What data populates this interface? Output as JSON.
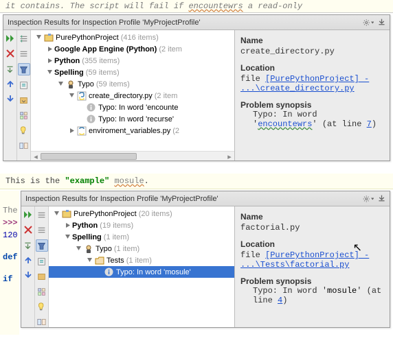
{
  "banner1": {
    "pre": "it contains. The script will fail if ",
    "typo": "encountewrs",
    "post": " a read-only"
  },
  "banner2": {
    "pre": "This is the ",
    "str": "\"example\"",
    "mid": " ",
    "typo": "mosule",
    "post": "."
  },
  "side": {
    "the": "The",
    "prompt": ">>>",
    "num": "120",
    "def": "def",
    "if": "if "
  },
  "panel1": {
    "title": "Inspection Results for Inspection Profile 'MyProjectProfile'",
    "tree": {
      "root": {
        "label": "PurePythonProject",
        "count": "(416 items)"
      },
      "gae": {
        "label": "Google App Engine (Python)",
        "count": "(2 item"
      },
      "python": {
        "label": "Python",
        "count": "(355 items)"
      },
      "spelling": {
        "label": "Spelling",
        "count": "(59 items)"
      },
      "typo": {
        "label": "Typo",
        "count": "(59 items)"
      },
      "file1": {
        "label": "create_directory.py",
        "count": "(2 item"
      },
      "msg1": "Typo: In word 'encounte",
      "msg2": "Typo: In word 'recurse'",
      "file2": {
        "label": "enviroment_variables.py",
        "count": "(2"
      }
    },
    "details": {
      "name_h": "Name",
      "name_v": "create_directory.py",
      "loc_h": "Location",
      "loc_pre": "file ",
      "loc_link": "[PurePythonProject] - ...\\create_directory.py",
      "syn_h": "Problem synopsis",
      "syn_pre": "Typo: In word '",
      "syn_word": "encountewrs",
      "syn_post": "' (at line ",
      "syn_line": "7",
      "syn_end": ")"
    }
  },
  "panel2": {
    "title": "Inspection Results for Inspection Profile 'MyProjectProfile'",
    "tree": {
      "root": {
        "label": "PurePythonProject",
        "count": "(20 items)"
      },
      "python": {
        "label": "Python",
        "count": "(19 items)"
      },
      "spelling": {
        "label": "Spelling",
        "count": "(1 item)"
      },
      "typo": {
        "label": "Typo",
        "count": "(1 item)"
      },
      "tests": {
        "label": "Tests",
        "count": "(1 item)"
      },
      "msg1": "Typo: In word 'mosule'"
    },
    "details": {
      "name_h": "Name",
      "name_v": "factorial.py",
      "loc_h": "Location",
      "loc_pre": "file ",
      "loc_link": "[PurePythonProject] - ...\\Tests\\factorial.py",
      "syn_h": "Problem synopsis",
      "syn_pre": "Typo: In word '",
      "syn_word": "mosule",
      "syn_post": "' (at line ",
      "syn_line": "4",
      "syn_end": ")"
    }
  },
  "chart_data": null
}
